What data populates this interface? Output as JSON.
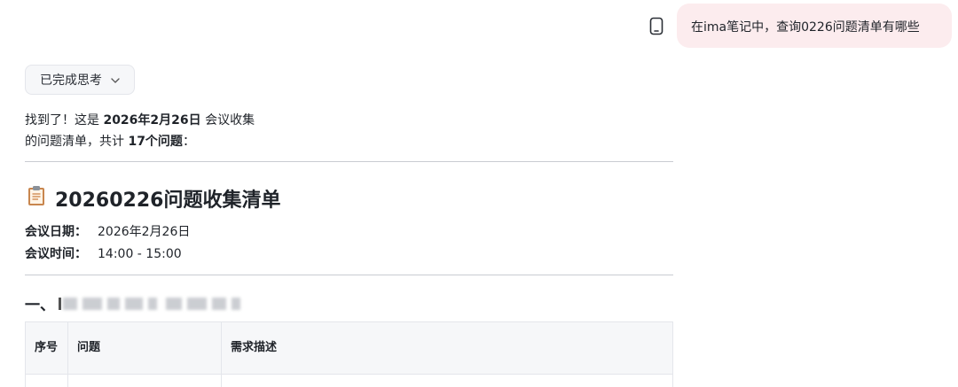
{
  "chat": {
    "user_message": "在ima笔记中，查询0226问题清单有哪些",
    "copy_icon": "phone-copy-icon"
  },
  "thinking": {
    "label": "已完成思考",
    "chevron_icon": "chevron-down-icon"
  },
  "answer": {
    "intro_part1": "找到了！这是 ",
    "intro_date": "2026年2月26日",
    "intro_part2": " 会议收集",
    "intro_line2_part1": "的问题清单，共计 ",
    "intro_count": "17个问题",
    "intro_line2_part2": "："
  },
  "document": {
    "title_icon": "clipboard-icon",
    "title": "20260226问题收集清单",
    "date_label": "会议日期：",
    "date_value": "2026年2月26日",
    "time_label": "会议时间：",
    "time_value": "14:00 - 15:00",
    "section_prefix": "一、",
    "table": {
      "columns": [
        "序号",
        "问题",
        "需求描述"
      ]
    }
  }
}
